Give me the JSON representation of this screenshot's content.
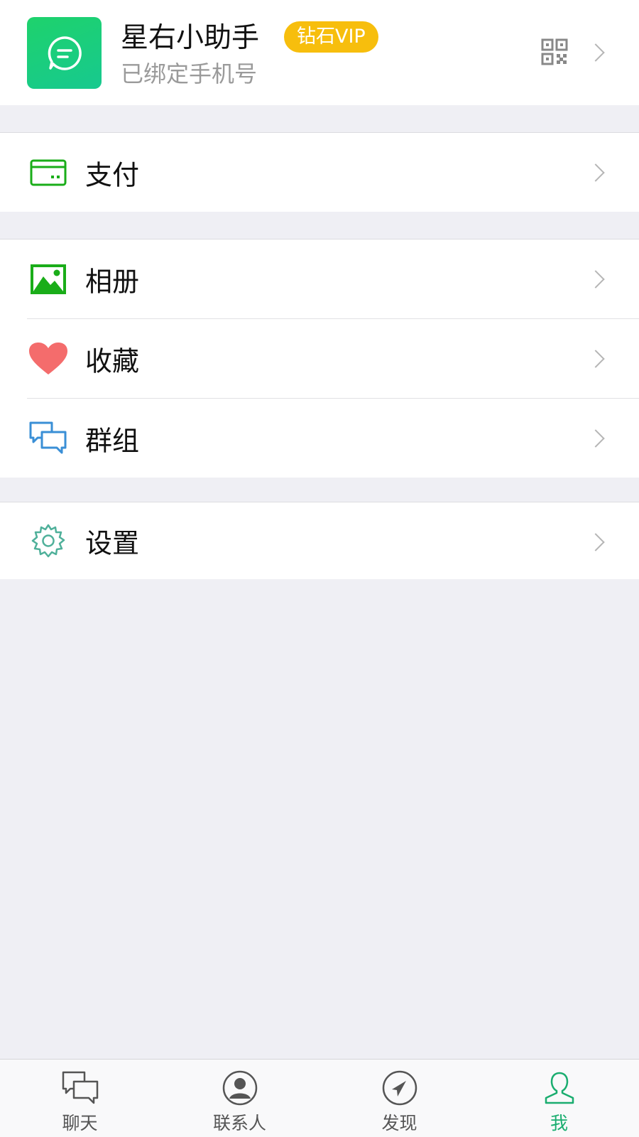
{
  "profile": {
    "name": "星右小助手",
    "badge": "钻石VIP",
    "subtitle": "已绑定手机号",
    "qr_icon": "qr-code-icon"
  },
  "menu": {
    "pay": {
      "label": "支付",
      "icon": "card-icon"
    },
    "album": {
      "label": "相册",
      "icon": "image-icon"
    },
    "favorites": {
      "label": "收藏",
      "icon": "heart-icon"
    },
    "groups": {
      "label": "群组",
      "icon": "chat-bubbles-icon"
    },
    "settings": {
      "label": "设置",
      "icon": "gear-icon"
    }
  },
  "tabbar": {
    "items": [
      {
        "label": "聊天",
        "icon": "chat-icon",
        "active": false
      },
      {
        "label": "联系人",
        "icon": "contacts-icon",
        "active": false
      },
      {
        "label": "发现",
        "icon": "compass-icon",
        "active": false
      },
      {
        "label": "我",
        "icon": "person-icon",
        "active": true
      }
    ]
  },
  "colors": {
    "accent": "#1aad6f",
    "badge": "#f7be0d",
    "background": "#efeff4",
    "heart": "#f46c6c",
    "groups_icon": "#3a8fd6"
  }
}
